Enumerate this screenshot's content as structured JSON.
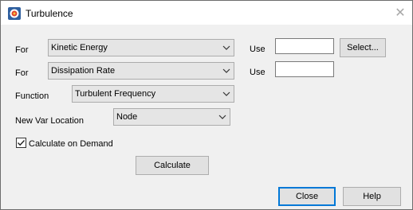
{
  "window": {
    "title": "Turbulence"
  },
  "icons": {
    "app": "tecplot-app-icon",
    "close": "close-icon",
    "dropdown": "chevron-down-icon",
    "check": "checkmark-icon"
  },
  "row1": {
    "label": "For",
    "selected": "Kinetic Energy",
    "use_label": "Use",
    "use_value": "",
    "select_button": "Select..."
  },
  "row2": {
    "label": "For",
    "selected": "Dissipation Rate",
    "use_label": "Use",
    "use_value": ""
  },
  "function": {
    "label": "Function",
    "selected": "Turbulent Frequency"
  },
  "location": {
    "label": "New Var Location",
    "selected": "Node"
  },
  "calculate_on_demand": {
    "label": "Calculate on Demand",
    "checked": true
  },
  "buttons": {
    "calculate": "Calculate",
    "close": "Close",
    "help": "Help"
  }
}
